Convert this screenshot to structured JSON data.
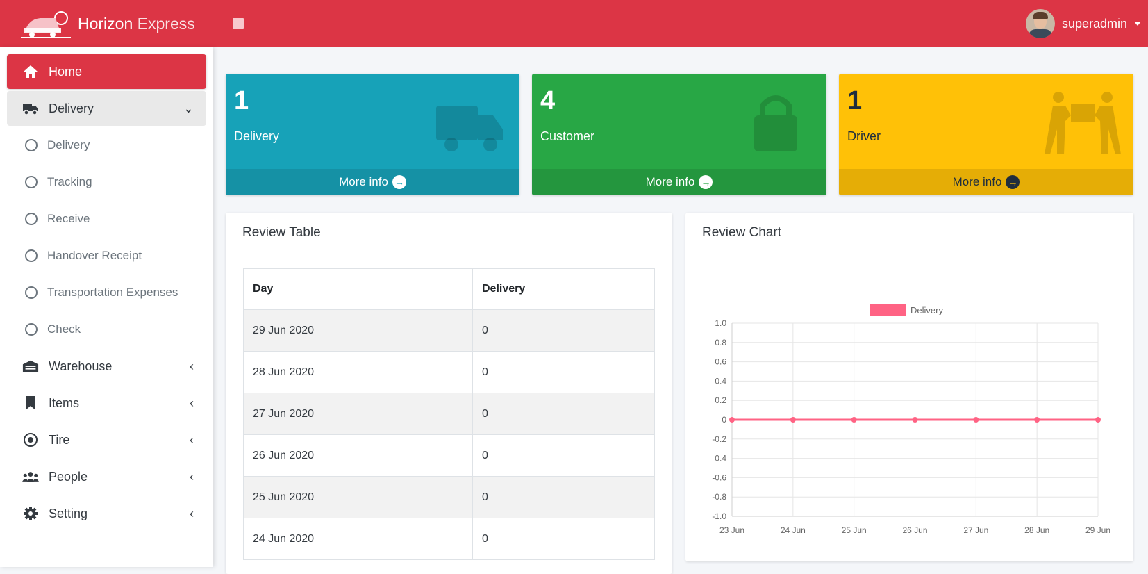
{
  "brand": {
    "name_part1": "Horizon ",
    "name_part2": "Express"
  },
  "user": {
    "name": "superadmin"
  },
  "sidebar": {
    "home": "Home",
    "delivery": "Delivery",
    "sub": [
      "Delivery",
      "Tracking",
      "Receive",
      "Handover Receipt",
      "Transportation Expenses",
      "Check"
    ],
    "warehouse": "Warehouse",
    "items": "Items",
    "tire": "Tire",
    "people": "People",
    "setting": "Setting"
  },
  "cards": [
    {
      "value": "1",
      "label": "Delivery",
      "more": "More info",
      "color": "#17a2b8"
    },
    {
      "value": "4",
      "label": "Customer",
      "more": "More info",
      "color": "#28a745"
    },
    {
      "value": "1",
      "label": "Driver",
      "more": "More info",
      "color": "#ffc107"
    }
  ],
  "review_table": {
    "title": "Review Table",
    "headers": [
      "Day",
      "Delivery"
    ],
    "rows": [
      [
        "29 Jun 2020",
        "0"
      ],
      [
        "28 Jun 2020",
        "0"
      ],
      [
        "27 Jun 2020",
        "0"
      ],
      [
        "26 Jun 2020",
        "0"
      ],
      [
        "25 Jun 2020",
        "0"
      ],
      [
        "24 Jun 2020",
        "0"
      ]
    ]
  },
  "review_chart": {
    "title": "Review Chart"
  },
  "chart_data": {
    "type": "line",
    "categories": [
      "23 Jun",
      "24 Jun",
      "25 Jun",
      "26 Jun",
      "27 Jun",
      "28 Jun",
      "29 Jun"
    ],
    "series": [
      {
        "name": "Delivery",
        "values": [
          0,
          0,
          0,
          0,
          0,
          0,
          0
        ],
        "color": "#ff6384"
      }
    ],
    "ylim": [
      -1.0,
      1.0
    ],
    "yticks": [
      "1.0",
      "0.8",
      "0.6",
      "0.4",
      "0.2",
      "0",
      "-0.2",
      "-0.4",
      "-0.6",
      "-0.8",
      "-1.0"
    ],
    "grid": true,
    "legend": "top-center"
  }
}
